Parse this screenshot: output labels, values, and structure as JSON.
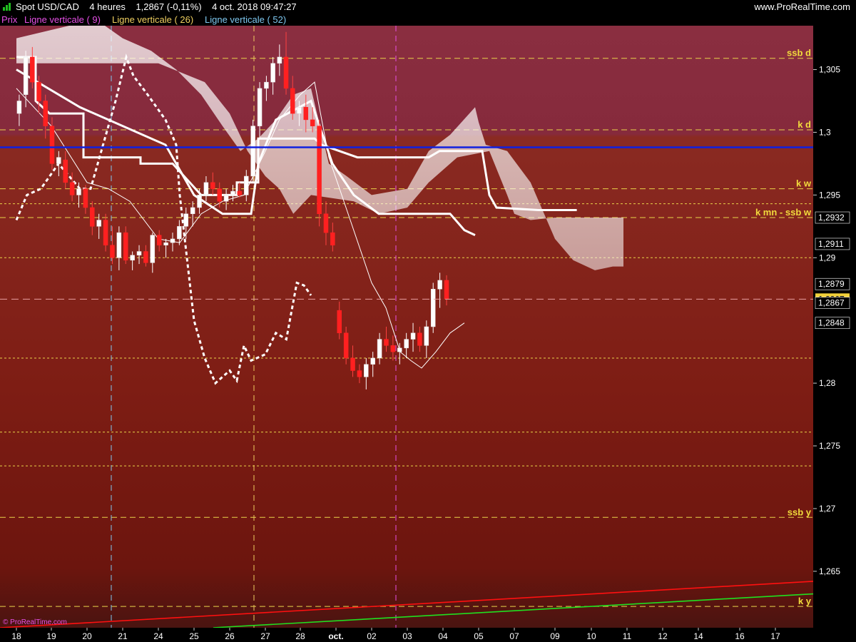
{
  "header": {
    "symbol": "Spot USD/CAD",
    "timeframe": "4 heures",
    "last": "1,2867 (-0,11%)",
    "datetime": "4 oct. 2018 09:47:27",
    "brand": "www.ProRealTime.com"
  },
  "legend": [
    {
      "text": "Prix",
      "color": "#e64fe6"
    },
    {
      "text": "Ligne verticale ( 9)",
      "color": "#e64fe6"
    },
    {
      "text": "Ligne verticale ( 26)",
      "color": "#f0d060"
    },
    {
      "text": "Ligne verticale ( 52)",
      "color": "#7ec8f0"
    }
  ],
  "copyright": "© ProRealTime.com",
  "chart_data": {
    "type": "candlestick",
    "ylim": [
      1.2605,
      1.3085
    ],
    "y_ticks": [
      "1,305",
      "1,3",
      "1,295",
      "1,29",
      "1,28",
      "1,275",
      "1,27",
      "1,265"
    ],
    "x_ticks": [
      "18",
      "19",
      "20",
      "21",
      "24",
      "25",
      "26",
      "27",
      "28",
      "oct.",
      "02",
      "03",
      "04",
      "05",
      "07",
      "09",
      "10",
      "11",
      "12",
      "14",
      "16",
      "17"
    ],
    "level_lines": [
      {
        "label": "ssb d",
        "y": 1.3059
      },
      {
        "label": "k d",
        "y": 1.3002
      },
      {
        "label": "k w",
        "y": 1.2955
      },
      {
        "label": "k mn - ssb w",
        "y": 1.2932
      },
      {
        "label": "",
        "y": 1.2943
      },
      {
        "label": "",
        "y": 1.29
      },
      {
        "label": "",
        "y": 1.282
      },
      {
        "label": "",
        "y": 1.2761
      },
      {
        "label": "",
        "y": 1.2734
      },
      {
        "label": "ssb y",
        "y": 1.2693
      },
      {
        "label": "k y",
        "y": 1.2622
      }
    ],
    "horizontal_line": {
      "y": 1.2988,
      "color": "#1020e0"
    },
    "price_tags": [
      {
        "text": "1,2932",
        "y": 1.2932,
        "style": "dark"
      },
      {
        "text": "1,2911",
        "y": 1.2911,
        "style": "dark"
      },
      {
        "text": "1,2879",
        "y": 1.2879,
        "style": "dark"
      },
      {
        "text": "1,2867",
        "y": 1.2867,
        "style": "current"
      },
      {
        "text": "1,2867",
        "y": 1.2864,
        "style": "dark"
      },
      {
        "text": "1,2848",
        "y": 1.2848,
        "style": "dark"
      }
    ],
    "current_price": 1.2867,
    "vertical_markers": [
      {
        "date": "21",
        "color": "#7ec8f0"
      },
      {
        "date": "27",
        "color": "#f0d060"
      },
      {
        "date": "03",
        "color": "#e64fe6"
      }
    ],
    "trend_lines": [
      {
        "color": "#ff1010",
        "from": {
          "date": "18",
          "price": 1.2605
        },
        "to": {
          "date": "17",
          "price": 1.2642
        }
      },
      {
        "color": "#20e020",
        "from": {
          "date": "26",
          "price": 1.2605
        },
        "to": {
          "date": "17",
          "price": 1.2632
        }
      }
    ],
    "candles": [
      [
        1.3015,
        1.303,
        1.3005,
        1.3025
      ],
      [
        1.303,
        1.3065,
        1.302,
        1.306
      ],
      [
        1.306,
        1.3068,
        1.3035,
        1.304
      ],
      [
        1.304,
        1.3045,
        1.3015,
        1.3025
      ],
      [
        1.3025,
        1.303,
        1.2995,
        1.3005
      ],
      [
        1.3005,
        1.3012,
        1.297,
        1.2975
      ],
      [
        1.2975,
        1.2985,
        1.2965,
        1.298
      ],
      [
        1.2978,
        1.2985,
        1.2955,
        1.296
      ],
      [
        1.296,
        1.2968,
        1.2945,
        1.295
      ],
      [
        1.295,
        1.296,
        1.294,
        1.2955
      ],
      [
        1.2955,
        1.2958,
        1.2935,
        1.294
      ],
      [
        1.294,
        1.2945,
        1.2918,
        1.2925
      ],
      [
        1.2925,
        1.2935,
        1.2915,
        1.293
      ],
      [
        1.293,
        1.2935,
        1.2905,
        1.291
      ],
      [
        1.291,
        1.2925,
        1.2895,
        1.29
      ],
      [
        1.29,
        1.2925,
        1.289,
        1.292
      ],
      [
        1.292,
        1.2925,
        1.2895,
        1.2898
      ],
      [
        1.2898,
        1.2905,
        1.289,
        1.2902
      ],
      [
        1.2902,
        1.291,
        1.2895,
        1.2905
      ],
      [
        1.2905,
        1.291,
        1.2893,
        1.2896
      ],
      [
        1.2896,
        1.292,
        1.2888,
        1.2918
      ],
      [
        1.2918,
        1.2922,
        1.2905,
        1.291
      ],
      [
        1.291,
        1.2915,
        1.29,
        1.2912
      ],
      [
        1.2912,
        1.292,
        1.2905,
        1.2915
      ],
      [
        1.2915,
        1.293,
        1.291,
        1.2925
      ],
      [
        1.2925,
        1.294,
        1.2915,
        1.2935
      ],
      [
        1.2935,
        1.2945,
        1.2925,
        1.294
      ],
      [
        1.294,
        1.2955,
        1.2935,
        1.295
      ],
      [
        1.295,
        1.2965,
        1.2945,
        1.296
      ],
      [
        1.296,
        1.2968,
        1.295,
        1.2955
      ],
      [
        1.2955,
        1.296,
        1.294,
        1.2945
      ],
      [
        1.2945,
        1.2955,
        1.2938,
        1.295
      ],
      [
        1.295,
        1.2958,
        1.2945,
        1.2953
      ],
      [
        1.2953,
        1.296,
        1.2948,
        1.295
      ],
      [
        1.295,
        1.297,
        1.2945,
        1.2965
      ],
      [
        1.2965,
        1.301,
        1.296,
        1.3005
      ],
      [
        1.3005,
        1.304,
        1.2995,
        1.3035
      ],
      [
        1.3035,
        1.3045,
        1.3025,
        1.304
      ],
      [
        1.304,
        1.306,
        1.303,
        1.3055
      ],
      [
        1.3055,
        1.307,
        1.3045,
        1.306
      ],
      [
        1.306,
        1.308,
        1.303,
        1.3035
      ],
      [
        1.3035,
        1.3045,
        1.301,
        1.3015
      ],
      [
        1.3015,
        1.3025,
        1.3005,
        1.302
      ],
      [
        1.302,
        1.303,
        1.3,
        1.301
      ],
      [
        1.301,
        1.302,
        1.3,
        1.3005
      ],
      [
        1.3005,
        1.301,
        1.2925,
        1.2935
      ],
      [
        1.2935,
        1.2945,
        1.291,
        1.292
      ],
      [
        1.292,
        1.2928,
        1.2905,
        1.291
      ],
      [
        1.2858,
        1.2865,
        1.2835,
        1.284
      ],
      [
        1.284,
        1.2845,
        1.2815,
        1.282
      ],
      [
        1.282,
        1.283,
        1.2805,
        1.281
      ],
      [
        1.281,
        1.2815,
        1.28,
        1.2805
      ],
      [
        1.2805,
        1.282,
        1.2795,
        1.2815
      ],
      [
        1.2815,
        1.2825,
        1.2805,
        1.282
      ],
      [
        1.282,
        1.284,
        1.2815,
        1.2835
      ],
      [
        1.2835,
        1.2845,
        1.2825,
        1.283
      ],
      [
        1.283,
        1.2838,
        1.2818,
        1.2825
      ],
      [
        1.2825,
        1.2832,
        1.2815,
        1.2828
      ],
      [
        1.2828,
        1.284,
        1.282,
        1.2835
      ],
      [
        1.2835,
        1.2848,
        1.2825,
        1.284
      ],
      [
        1.284,
        1.2845,
        1.2825,
        1.283
      ],
      [
        1.283,
        1.285,
        1.282,
        1.2845
      ],
      [
        1.2845,
        1.288,
        1.284,
        1.2875
      ],
      [
        1.2875,
        1.2888,
        1.286,
        1.2882
      ],
      [
        1.2882,
        1.2886,
        1.2862,
        1.2867
      ]
    ],
    "kijun_daily": [
      [
        0,
        1.306
      ],
      [
        0.55,
        1.306
      ],
      [
        0.55,
        1.3025
      ],
      [
        0.95,
        1.3015
      ],
      [
        1.9,
        1.3015
      ],
      [
        1.9,
        1.298
      ],
      [
        3.5,
        1.298
      ],
      [
        3.5,
        1.2975
      ],
      [
        4.4,
        1.2975
      ],
      [
        5.2,
        1.295
      ],
      [
        6.2,
        1.295
      ],
      [
        6.2,
        1.296
      ],
      [
        6.8,
        1.296
      ],
      [
        6.8,
        1.2995
      ],
      [
        7.8,
        1.2995
      ],
      [
        8.4,
        1.2995
      ],
      [
        8.6,
        1.299
      ],
      [
        9.6,
        1.298
      ],
      [
        11.6,
        1.298
      ],
      [
        11.9,
        1.2985
      ],
      [
        13.1,
        1.2985
      ],
      [
        13.3,
        1.295
      ],
      [
        13.5,
        1.294
      ],
      [
        14.6,
        1.2938
      ],
      [
        15.6,
        1.2938
      ]
    ],
    "kijun_4h": [
      [
        0,
        1.305
      ],
      [
        1.8,
        1.302
      ],
      [
        4.2,
        1.299
      ],
      [
        5.0,
        1.295
      ],
      [
        5.8,
        1.2935
      ],
      [
        6.6,
        1.2935
      ],
      [
        6.8,
        1.2975
      ],
      [
        7.3,
        1.301
      ],
      [
        8.3,
        1.3025
      ],
      [
        8.9,
        1.2975
      ],
      [
        9.5,
        1.295
      ],
      [
        10.2,
        1.2935
      ],
      [
        12.2,
        1.2935
      ],
      [
        12.6,
        1.2922
      ],
      [
        12.9,
        1.2918
      ]
    ],
    "tenkan": [
      [
        0,
        1.3035
      ],
      [
        1,
        1.3005
      ],
      [
        2,
        1.296
      ],
      [
        2.6,
        1.2955
      ],
      [
        3.2,
        1.2945
      ],
      [
        4,
        1.2915
      ],
      [
        4.6,
        1.2912
      ],
      [
        5.2,
        1.2935
      ],
      [
        5.8,
        1.2945
      ],
      [
        6.4,
        1.295
      ],
      [
        7.0,
        1.2985
      ],
      [
        7.4,
        1.301
      ],
      [
        8,
        1.303
      ],
      [
        8.4,
        1.304
      ],
      [
        8.8,
        1.298
      ],
      [
        9.4,
        1.293
      ],
      [
        10,
        1.288
      ],
      [
        10.4,
        1.286
      ],
      [
        10.8,
        1.2825
      ],
      [
        11.1,
        1.2818
      ],
      [
        11.4,
        1.2812
      ],
      [
        11.8,
        1.2825
      ],
      [
        12.2,
        1.284
      ],
      [
        12.6,
        1.2848
      ]
    ],
    "chikou": [
      [
        0,
        1.293
      ],
      [
        0.3,
        1.295
      ],
      [
        0.7,
        1.2955
      ],
      [
        1.2,
        1.2975
      ],
      [
        1.5,
        1.2965
      ],
      [
        1.8,
        1.2955
      ],
      [
        2.1,
        1.2955
      ],
      [
        2.5,
        1.2995
      ],
      [
        2.8,
        1.3025
      ],
      [
        3.1,
        1.306
      ],
      [
        3.3,
        1.3045
      ],
      [
        3.7,
        1.303
      ],
      [
        4.2,
        1.301
      ],
      [
        4.5,
        1.299
      ],
      [
        4.6,
        1.295
      ],
      [
        4.8,
        1.29
      ],
      [
        5.0,
        1.285
      ],
      [
        5.3,
        1.282
      ],
      [
        5.6,
        1.28
      ],
      [
        6.0,
        1.281
      ],
      [
        6.2,
        1.2802
      ],
      [
        6.4,
        1.283
      ],
      [
        6.6,
        1.2818
      ],
      [
        7.0,
        1.2823
      ],
      [
        7.3,
        1.284
      ],
      [
        7.6,
        1.2835
      ],
      [
        7.9,
        1.288
      ],
      [
        8.1,
        1.2878
      ],
      [
        8.3,
        1.287
      ]
    ],
    "cloud_upper": [
      [
        0,
        1.3075
      ],
      [
        1.5,
        1.3085
      ],
      [
        2.5,
        1.3085
      ],
      [
        3.0,
        1.3075
      ],
      [
        3.8,
        1.3065
      ],
      [
        4.5,
        1.305
      ],
      [
        5.2,
        1.303
      ],
      [
        5.8,
        1.3005
      ],
      [
        6.3,
        1.2985
      ],
      [
        6.8,
        1.2995
      ],
      [
        7.3,
        1.301
      ],
      [
        7.8,
        1.303
      ],
      [
        8.3,
        1.3035
      ],
      [
        8.8,
        1.2975
      ],
      [
        9.3,
        1.2965
      ],
      [
        10.0,
        1.295
      ],
      [
        11.0,
        1.2955
      ],
      [
        11.6,
        1.2985
      ],
      [
        12.2,
        1.2998
      ],
      [
        12.9,
        1.302
      ],
      [
        13.0,
        1.3008
      ],
      [
        13.2,
        1.299
      ],
      [
        13.8,
        1.2985
      ],
      [
        14.4,
        1.296
      ],
      [
        15.0,
        1.2915
      ],
      [
        15.5,
        1.2898
      ],
      [
        16.1,
        1.289
      ],
      [
        16.6,
        1.2893
      ],
      [
        16.9,
        1.2893
      ]
    ],
    "cloud_lower": [
      [
        0,
        1.3055
      ],
      [
        2.5,
        1.3055
      ],
      [
        4.0,
        1.3055
      ],
      [
        5.3,
        1.304
      ],
      [
        6.0,
        1.3015
      ],
      [
        6.5,
        1.2985
      ],
      [
        7.0,
        1.2965
      ],
      [
        7.4,
        1.2955
      ],
      [
        7.8,
        1.2935
      ],
      [
        8.3,
        1.295
      ],
      [
        9.5,
        1.2945
      ],
      [
        10.2,
        1.2935
      ],
      [
        11.0,
        1.294
      ],
      [
        11.6,
        1.296
      ],
      [
        12.4,
        1.298
      ],
      [
        13.3,
        1.2985
      ],
      [
        13.8,
        1.295
      ],
      [
        14.0,
        1.2935
      ],
      [
        14.4,
        1.293
      ],
      [
        15.0,
        1.2932
      ],
      [
        16.0,
        1.2932
      ],
      [
        16.9,
        1.2932
      ]
    ]
  }
}
